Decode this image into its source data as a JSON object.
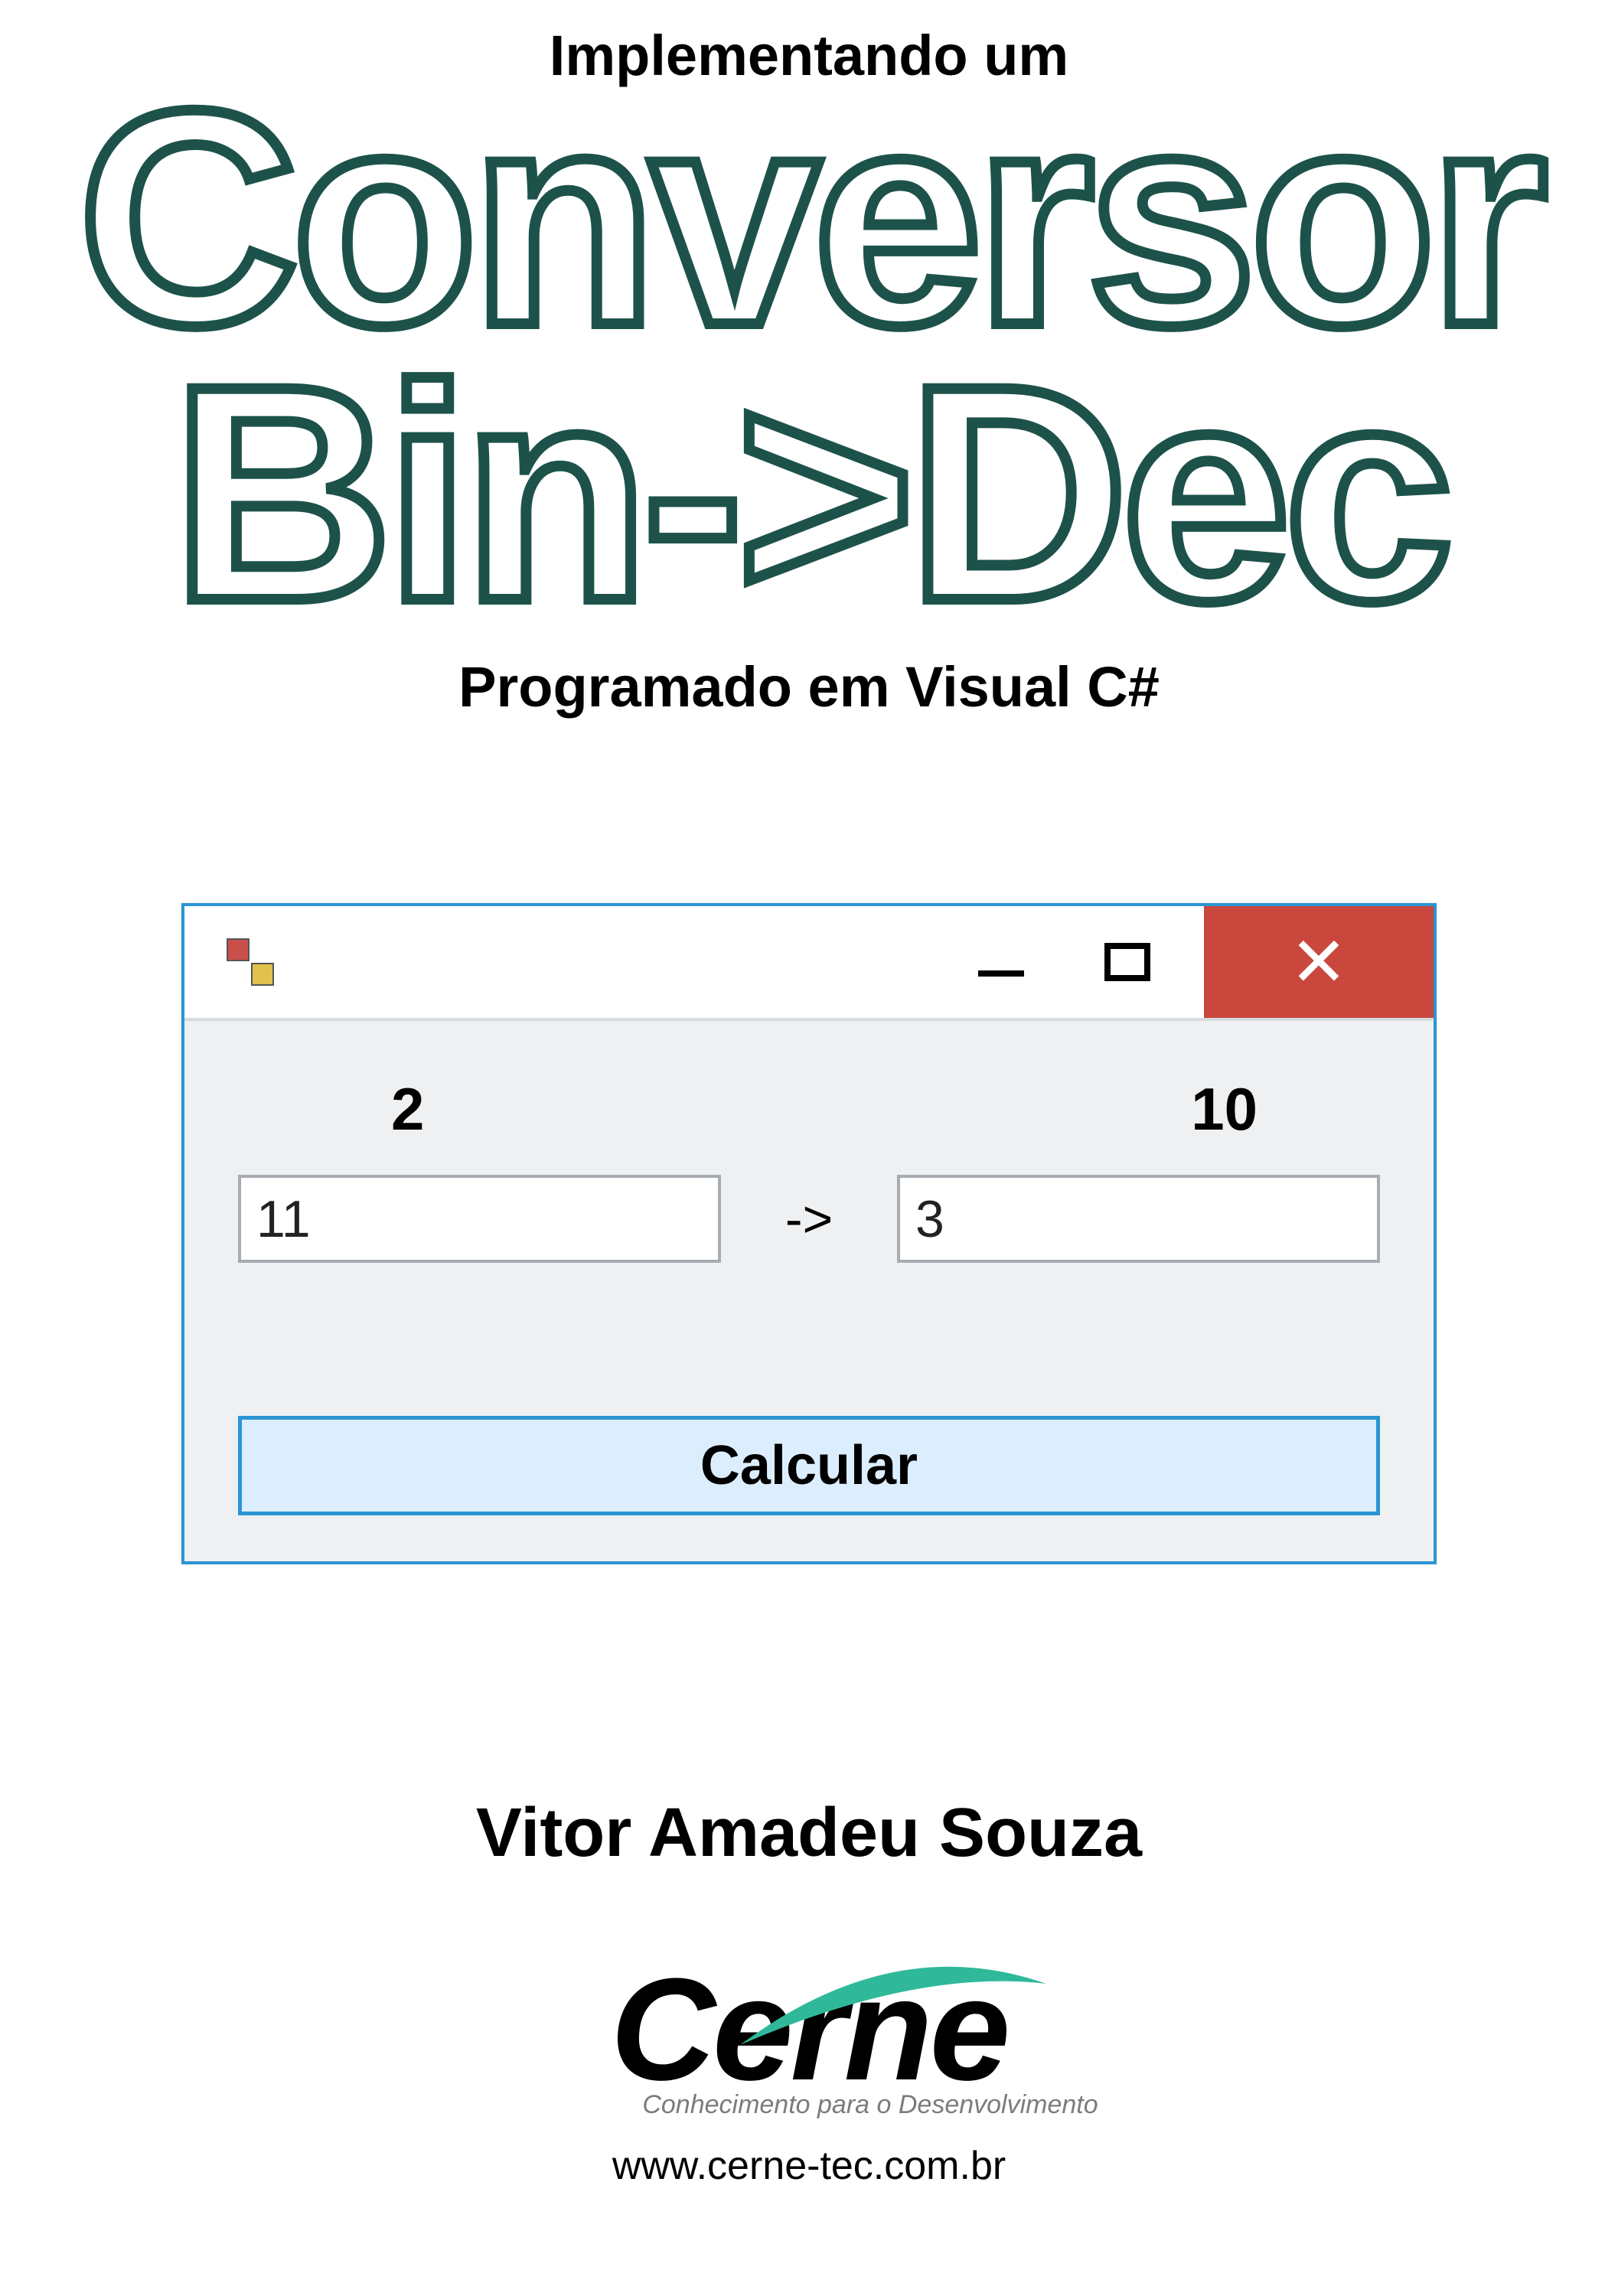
{
  "cover": {
    "supertitle": "Implementando um",
    "title_line1": "Conversor",
    "title_line2": "Bin->Dec",
    "subtitle": "Programado em Visual C#",
    "author": "Vitor Amadeu Souza"
  },
  "window": {
    "labels": {
      "left": "2",
      "right": "10"
    },
    "inputs": {
      "binary": "11",
      "decimal": "3"
    },
    "arrow": "->",
    "button": "Calcular"
  },
  "publisher": {
    "name": "Cerne",
    "tagline": "Conhecimento para o Desenvolvimento",
    "url": "www.cerne-tec.com.br"
  },
  "colors": {
    "outline": "#1d524a",
    "window_border": "#2a95d4",
    "close_red": "#c9473d",
    "client_bg": "#eef0f2",
    "button_bg": "#dceefe",
    "swoosh": "#2fb99a"
  }
}
